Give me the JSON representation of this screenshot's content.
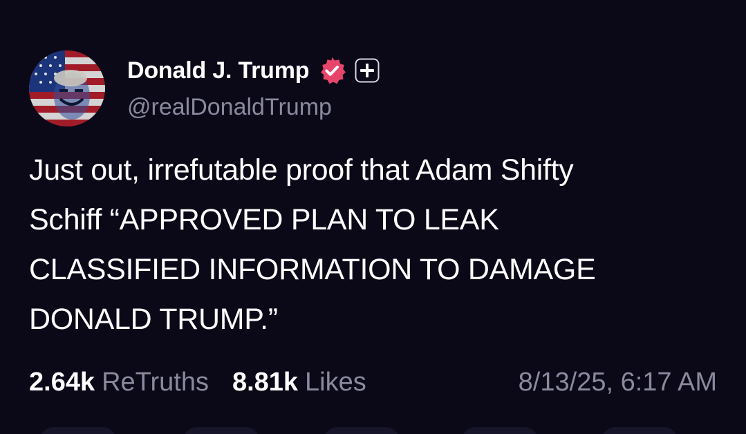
{
  "author": {
    "display_name": "Donald J. Trump",
    "handle": "@realDonaldTrump",
    "verified": true,
    "badge_color": "#e8456b",
    "avatar_icon": "flag-portrait-avatar",
    "plus_icon": "plus-badge-icon"
  },
  "post": {
    "lines": [
      "Just out, irrefutable proof that Adam Shifty",
      "Schiff “APPROVED PLAN TO LEAK",
      "CLASSIFIED INFORMATION TO DAMAGE",
      "DONALD TRUMP.”"
    ]
  },
  "stats": {
    "retruths_count": "2.64k",
    "retruths_label": "ReTruths",
    "likes_count": "8.81k",
    "likes_label": "Likes",
    "timestamp": "8/13/25, 6:17 AM"
  },
  "theme": {
    "background": "#0b0918",
    "text_primary": "#ffffff",
    "text_secondary": "#8a8a9e"
  }
}
